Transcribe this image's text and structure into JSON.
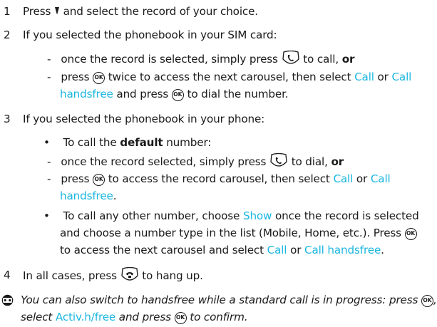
{
  "steps": [
    {
      "number": "1",
      "text_a": "Press",
      "text_b": "and select the record of your choice."
    },
    {
      "number": "2",
      "text": "If you selected the phonebook in your SIM card:"
    },
    {
      "number": "3",
      "text": "If you selected the phonebook in your phone:"
    },
    {
      "number": "4",
      "text_a": "In all cases, press",
      "text_b": "to hang up."
    }
  ],
  "step2": {
    "dash1_a": "once the record is selected, simply press",
    "dash1_b": "to call,",
    "or": "or",
    "dash2_a": "press",
    "dash2_b": "twice to access the next carousel, then select",
    "call": "Call",
    "or_word": "or",
    "call_handsfree_1": "Call",
    "call_handsfree_2": "handsfree",
    "dash2_c": "and press",
    "dash2_d": "to  dial the number."
  },
  "step3": {
    "bullet1_a": "To call the",
    "bullet1_bold": "default",
    "bullet1_b": "number:",
    "dash1_a": "once the record selected, simply press",
    "dash1_b": "to dial,",
    "or": "or",
    "dash2_a": "press",
    "dash2_b": "to access the record carousel, then select",
    "call": "Call",
    "or_word": "or",
    "call_handsfree_1": "Call",
    "call_handsfree_2": "handsfree",
    "period": ".",
    "bullet2_a": "To call any other number, choose",
    "show": "Show",
    "bullet2_b": "once the record is selected",
    "bullet2_c": "and choose a number type in the list (Mobile, Home, etc.). Press",
    "bullet2_d": "to access the next carousel and select",
    "call2": "Call",
    "or_word2": "or",
    "call_handsfree2": "Call handsfree",
    "period2": "."
  },
  "note": {
    "a": "You can also switch to handsfree while a standard call is in progress: press",
    "comma": ",",
    "b": "select",
    "activ": "Activ.h/free",
    "c": "and press",
    "d": "to confirm."
  },
  "symbols": {
    "dash": "-",
    "bullet": "•",
    "ok_label": "OK"
  },
  "icons": [
    "down-arrow-icon",
    "call-button-icon",
    "ok-key-icon",
    "hang-up-button-icon",
    "info-icon"
  ],
  "colors": {
    "text": "#1a1a1a",
    "link": "#1bb7e0"
  }
}
